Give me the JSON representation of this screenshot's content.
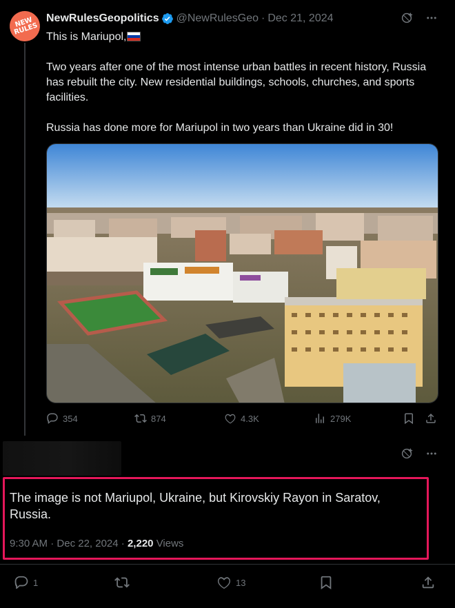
{
  "tweet": {
    "avatar_text": "NEW RULES",
    "display_name": "NewRulesGeopolitics",
    "handle": "@NewRulesGeo",
    "separator": "·",
    "date": "Dec 21, 2024",
    "text_line1": "This is Mariupol,",
    "text_para2": "Two years after one of the most intense urban battles in recent history, Russia has rebuilt the city. New residential buildings, schools, churches, and sports facilities.",
    "text_para3": "Russia has done more for Mariupol in two years than Ukraine did in 30!",
    "flag_colors": [
      "#ffffff",
      "#0039a6",
      "#d52b1e"
    ],
    "stats": {
      "replies": "354",
      "reposts": "874",
      "likes": "4.3K",
      "views": "279K"
    }
  },
  "reply": {
    "note": "The image is not Mariupol, Ukraine, but Kirovskiy Rayon in Saratov, Russia.",
    "time": "9:30 AM",
    "separator": "·",
    "date": "Dec 22, 2024",
    "views_count": "2,220",
    "views_label": "Views",
    "stats": {
      "replies": "1",
      "likes": "13"
    }
  },
  "colors": {
    "background": "#000000",
    "text_primary": "#e7e9ea",
    "text_secondary": "#71767b",
    "verified_blue": "#1d9bf0",
    "highlight_box": "#e5175a",
    "avatar_bg": "#f26b4f"
  },
  "icons": [
    "verified-icon",
    "grok-icon",
    "more-icon",
    "reply-icon",
    "repost-icon",
    "like-icon",
    "views-icon",
    "bookmark-icon",
    "share-icon"
  ]
}
